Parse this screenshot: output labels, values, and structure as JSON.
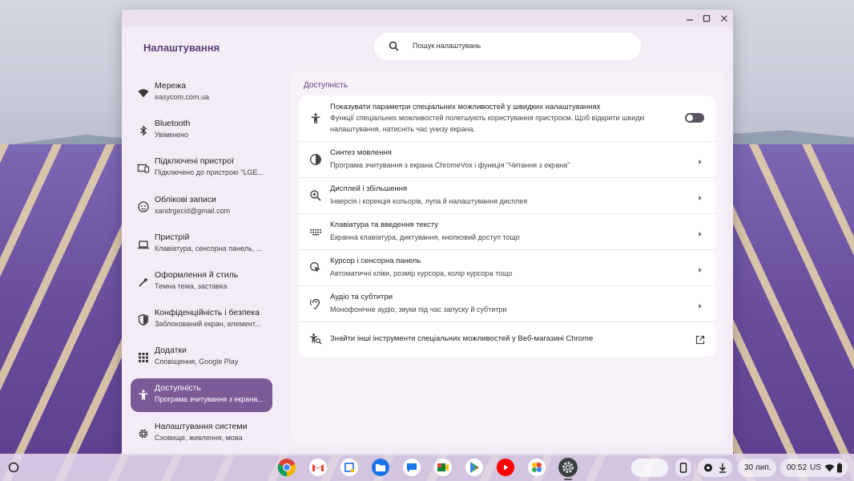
{
  "window": {
    "app_title": "Налаштування",
    "search_placeholder": "Пошук налаштувань"
  },
  "sidebar": {
    "items": [
      {
        "title": "Мережа",
        "subtitle": "easycom.com.ua",
        "icon": "wifi-icon"
      },
      {
        "title": "Bluetooth",
        "subtitle": "Увімкнено",
        "icon": "bluetooth-icon"
      },
      {
        "title": "Підключені пристрої",
        "subtitle": "Підключено до пристрою \"LGE...",
        "icon": "connected-devices-icon"
      },
      {
        "title": "Облікові записи",
        "subtitle": "xandrgecid@gmail.com",
        "icon": "account-icon"
      },
      {
        "title": "Пристрій",
        "subtitle": "Клавіатура, сенсорна панель, ...",
        "icon": "laptop-icon"
      },
      {
        "title": "Оформлення й стиль",
        "subtitle": "Темна тема, заставка",
        "icon": "palette-icon"
      },
      {
        "title": "Конфіденційність і безпека",
        "subtitle": "Заблокований екран, елемент...",
        "icon": "shield-icon"
      },
      {
        "title": "Додатки",
        "subtitle": "Сповіщення, Google Play",
        "icon": "apps-grid-icon"
      },
      {
        "title": "Доступність",
        "subtitle": "Програма зчитування з екрана...",
        "icon": "accessibility-icon",
        "active": true
      },
      {
        "title": "Налаштування системи",
        "subtitle": "Сховище, живлення, мова",
        "icon": "gear-icon"
      }
    ]
  },
  "main": {
    "heading": "Доступність",
    "rows": [
      {
        "title": "Показувати параметри спеціальних можливостей у швидких налаштуваннях",
        "desc": "Функції спеціальних можливостей полегшують користування пристроєм. Щоб відкрити швидкі налаштування, натисніть час унизу екрана.",
        "icon": "accessibility-icon",
        "control": "toggle",
        "toggle_on": false
      },
      {
        "title": "Синтез мовлення",
        "desc": "Програма зчитування з екрана ChromeVox і функція \"Читання з екрана\"",
        "icon": "text-to-speech-icon",
        "control": "chevron"
      },
      {
        "title": "Дисплей і збільшення",
        "desc": "Інверсія і корекція кольорів, лупа й налаштування дисплея",
        "icon": "zoom-in-icon",
        "control": "chevron"
      },
      {
        "title": "Клавіатура та введення тексту",
        "desc": "Екранна клавіатура, диктування, кнопковий доступ тощо",
        "icon": "keyboard-icon",
        "control": "chevron"
      },
      {
        "title": "Курсор і сенсорна панель",
        "desc": "Автоматичні кліки, розмір курсора, колір курсора тощо",
        "icon": "cursor-icon",
        "control": "chevron"
      },
      {
        "title": "Аудіо та субтитри",
        "desc": "Монофонічне аудіо, звуки під час запуску й субтитри",
        "icon": "hearing-icon",
        "control": "chevron"
      },
      {
        "title": "Знайти інші інструменти спеціальних можливостей у Веб-магазині Chrome",
        "desc": "",
        "icon": "accessibility-search-icon",
        "control": "external-link"
      }
    ]
  },
  "shelf": {
    "apps": [
      "chrome-icon",
      "gmail-icon",
      "calendar-icon",
      "files-icon",
      "messages-icon",
      "meet-icon",
      "play-store-icon",
      "youtube-icon",
      "photos-icon",
      "settings-icon"
    ],
    "date": "30 лип.",
    "time": "00:52",
    "locale": "US"
  },
  "colors": {
    "accent": "#7b5a98",
    "heading": "#5b3e7a",
    "window_bg": "#f3ecf6"
  }
}
